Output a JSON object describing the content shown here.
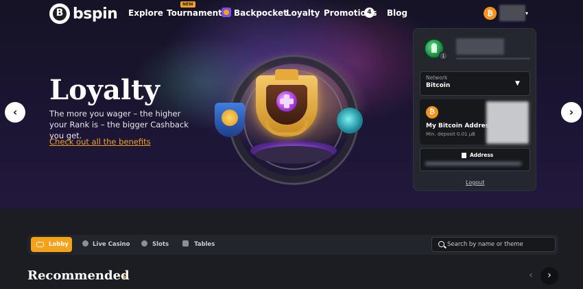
{
  "brand": {
    "logo_glyph": "B",
    "name": "bspin"
  },
  "nav": {
    "explore": "Explore",
    "tournament": "Tournament",
    "tournament_badge": "NEW",
    "backpocket": "Backpocket",
    "loyalty": "Loyalty",
    "promotions": "Promotions",
    "promotions_count": "4",
    "blog": "Blog"
  },
  "user": {
    "currency_glyph": "₿",
    "caret": "▾"
  },
  "hero": {
    "title": "Loyalty",
    "subtitle": "The more you wager – the higher your Rank is – the bigger Cashback you get.",
    "link": "Check out all the benefits",
    "prev": "‹",
    "next": "›"
  },
  "wallet": {
    "level": "1",
    "network_label": "Network",
    "network_value": "Bitcoin",
    "network_caret": "▼",
    "currency_glyph": "₿",
    "address_title": "My Bitcoin Address",
    "min_deposit": "Min. deposit 0.01 µB",
    "address_button": "Address",
    "logout": "Logout"
  },
  "lobby": {
    "tabs": [
      "Lobby",
      "Live Casino",
      "Slots",
      "Tables"
    ],
    "search_placeholder": "Search by name or theme"
  },
  "recommended": {
    "title": "Recommended",
    "chevron": "›",
    "prev": "‹",
    "next": "›"
  },
  "colors": {
    "accent": "#f4a21a",
    "bitcoin": "#f7931a",
    "background": "#1b1d22"
  }
}
